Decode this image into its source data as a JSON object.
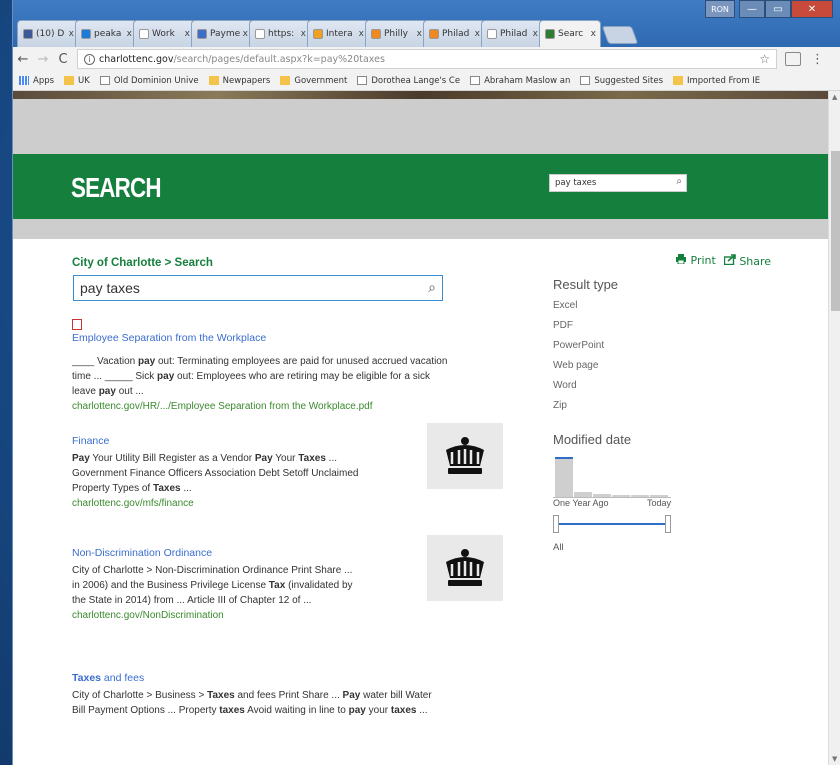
{
  "window": {
    "profile_label": "RON",
    "min_glyph": "—",
    "max_glyph": "▭",
    "close_glyph": "✕"
  },
  "tabs": [
    {
      "label": "(10) D",
      "color": "#3b5998",
      "active": false
    },
    {
      "label": "peaka",
      "color": "#1c7bd8",
      "active": false
    },
    {
      "label": "Work",
      "color": "#ffffff",
      "active": false
    },
    {
      "label": "Payme",
      "color": "#3f6ec6",
      "active": false
    },
    {
      "label": "https:",
      "color": "#ffffff",
      "active": false
    },
    {
      "label": "Intera",
      "color": "#f0a020",
      "active": false
    },
    {
      "label": "Philly",
      "color": "#f08a20",
      "active": false
    },
    {
      "label": "Philad",
      "color": "#f08a20",
      "active": false
    },
    {
      "label": "Philad",
      "color": "#ffffff",
      "active": false
    },
    {
      "label": "Searc",
      "color": "#2e7d32",
      "active": true
    }
  ],
  "tab_close": "x",
  "nav": {
    "back": "←",
    "forward": "→",
    "reload": "C",
    "info": "i",
    "url_host": "charlottenc.gov",
    "url_path": "/search/pages/default.aspx?k=pay%20taxes",
    "star": "☆",
    "menu": "⋮"
  },
  "bookmarks": [
    {
      "label": "Apps",
      "kind": "apps"
    },
    {
      "label": "UK",
      "kind": "folder"
    },
    {
      "label": "Old Dominion Unive",
      "kind": "page"
    },
    {
      "label": "Newpapers",
      "kind": "folder"
    },
    {
      "label": "Government",
      "kind": "folder"
    },
    {
      "label": "Dorothea Lange's Ce",
      "kind": "page"
    },
    {
      "label": "Abraham Maslow an",
      "kind": "page"
    },
    {
      "label": "Suggested Sites",
      "kind": "page"
    },
    {
      "label": "Imported From IE",
      "kind": "folder"
    }
  ],
  "header": {
    "title": "SEARCH",
    "search_value": "pay taxes",
    "search_glyph": "⌕"
  },
  "breadcrumb": "City of Charlotte > Search",
  "print_label": "Print",
  "share_label": "Share",
  "main_search_value": "pay taxes",
  "results": [
    {
      "title": "Employee Separation from the Workplace",
      "desc_html": "____ Vacation <b>pay</b> out: Terminating employees are paid for unused accrued vacation time ... _____ Sick <b>pay</b> out: Employees who are retiring may be eligible for a sick leave <b>pay</b> out ...",
      "url": "charlottenc.gov/HR/.../Employee Separation from the Workplace.pdf"
    },
    {
      "title": "Finance",
      "desc_html": "<b>Pay</b> Your Utility Bill Register as a Vendor <b>Pay</b> Your <b>Taxes</b> ... Government Finance Officers Association Debt Setoff Unclaimed Property Types of <b>Taxes</b> ...",
      "url": "charlottenc.gov/mfs/finance"
    },
    {
      "title": "Non-Discrimination Ordinance",
      "desc_html": "City of Charlotte > Non-Discrimination Ordinance  Print  Share ... in 2006) and the Business Privilege License <b>Tax</b> (invalidated by the State in 2014) from ... Article III of Chapter 12 of ...",
      "url": "charlottenc.gov/NonDiscrimination"
    },
    {
      "title_html": "<b>Taxes</b> and fees",
      "desc_html": "City of Charlotte > Business > <b>Taxes</b> and fees  Print  Share ... <b>Pay</b> water bill Water Bill Payment Options ... Property <b>taxes</b> Avoid waiting in line to <b>pay</b> your <b>taxes</b> ...",
      "url": ""
    }
  ],
  "refiners": {
    "result_type_title": "Result type",
    "result_types": [
      "Excel",
      "PDF",
      "PowerPoint",
      "Web page",
      "Word",
      "Zip"
    ],
    "modified_title": "Modified date",
    "histogram": [
      1.0,
      0.13,
      0.07,
      0.05,
      0.04,
      0.04
    ],
    "range_start_label": "One Year Ago",
    "range_end_label": "Today",
    "all_label": "All"
  }
}
